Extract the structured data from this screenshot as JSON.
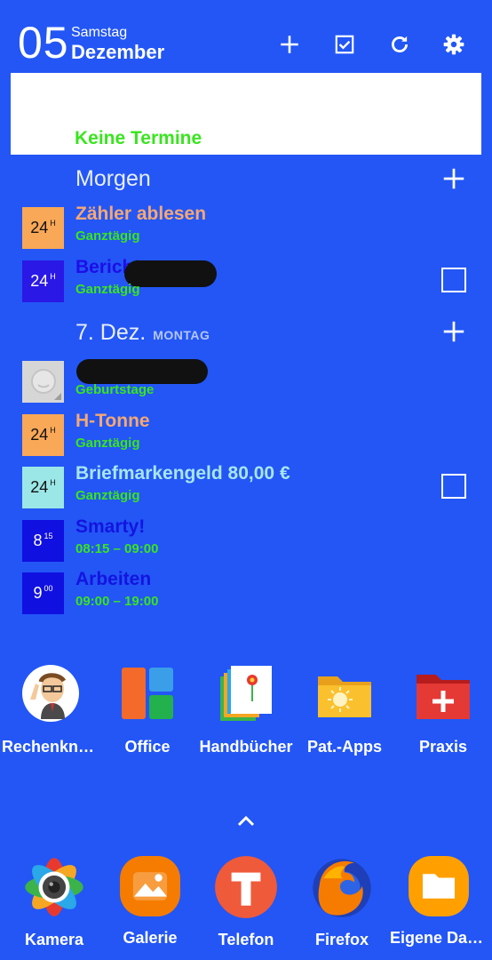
{
  "header": {
    "day": "05",
    "weekday": "Samstag",
    "month": "Dezember"
  },
  "today": {
    "empty_text": "Keine Termine"
  },
  "sections": [
    {
      "title": "Morgen",
      "events": [
        {
          "icon_text": "24",
          "icon_sup": "H",
          "icon_bg": "#f9a857",
          "title": "Zähler ablesen",
          "title_color": "#f6a873",
          "subtitle": "Ganztägig",
          "checkbox": false
        },
        {
          "icon_text": "24",
          "icon_sup": "H",
          "icon_bg": "#2a18e6",
          "title": "Bericht",
          "title_color": "#1d0ee8",
          "subtitle": "Ganztägig",
          "checkbox": true
        }
      ]
    },
    {
      "title": "7. Dez.",
      "subtitle": "MONTAG",
      "events": [
        {
          "icon_text": "",
          "icon_bg": "#d9d9d9",
          "title": "",
          "subtitle": "Geburtstage",
          "checkbox": false,
          "avatar": true
        },
        {
          "icon_text": "24",
          "icon_sup": "H",
          "icon_bg": "#f9a857",
          "title": "H-Tonne",
          "title_color": "#f6a873",
          "subtitle": "Ganztägig",
          "checkbox": false
        },
        {
          "icon_text": "24",
          "icon_sup": "H",
          "icon_bg": "#9be7e7",
          "title": "Briefmarkengeld 80,00 €",
          "title_color": "#a7e6f0",
          "subtitle": "Ganztägig",
          "checkbox": true
        },
        {
          "icon_text": "8",
          "icon_sup": "15",
          "icon_bg": "#1010e0",
          "title": "Smarty!",
          "title_color": "#1414e0",
          "subtitle": "08:15 – 09:00",
          "checkbox": false
        },
        {
          "icon_text": "9",
          "icon_sup": "00",
          "icon_bg": "#1010e0",
          "title": "Arbeiten",
          "title_color": "#1414e0",
          "subtitle": "09:00 – 19:00",
          "checkbox": false
        }
      ]
    }
  ],
  "apps": [
    {
      "label": "Rechenkne…",
      "icon": "caricature-avatar-icon"
    },
    {
      "label": "Office",
      "icon": "office-folder-icon"
    },
    {
      "label": "Handbücher",
      "icon": "manuals-folder-icon"
    },
    {
      "label": "Pat.-Apps",
      "icon": "sun-folder-icon"
    },
    {
      "label": "Praxis",
      "icon": "plus-folder-icon"
    }
  ],
  "dock": [
    {
      "label": "Kamera",
      "icon": "camera-icon"
    },
    {
      "label": "Galerie",
      "icon": "gallery-icon"
    },
    {
      "label": "Telefon",
      "icon": "telefon-icon"
    },
    {
      "label": "Firefox",
      "icon": "firefox-icon"
    },
    {
      "label": "Eigene Dat…",
      "icon": "files-icon"
    }
  ],
  "colors": {
    "background": "#2356f5",
    "green_text": "#39e51e",
    "white": "#ffffff"
  }
}
